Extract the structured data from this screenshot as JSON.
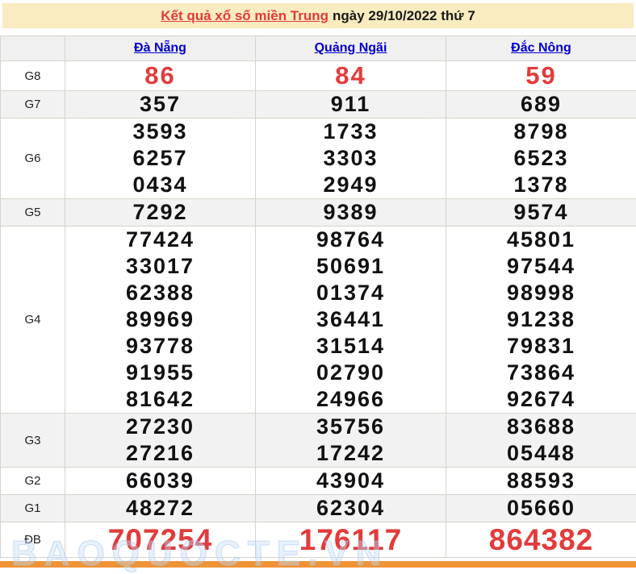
{
  "page": {
    "title_link": "Kết quả xổ số miền Trung",
    "title_rest": "ngày 29/10/2022 thứ 7"
  },
  "table": {
    "columns": [
      "Đà Nẵng",
      "Quảng Ngãi",
      "Đắc Nông"
    ],
    "rows": [
      {
        "label": "G8",
        "shade": "white",
        "variant": "red-medium",
        "values": [
          [
            "86"
          ],
          [
            "84"
          ],
          [
            "59"
          ]
        ]
      },
      {
        "label": "G7",
        "shade": "gray",
        "variant": "normal",
        "values": [
          [
            "357"
          ],
          [
            "911"
          ],
          [
            "689"
          ]
        ]
      },
      {
        "label": "G6",
        "shade": "white",
        "variant": "normal",
        "values": [
          [
            "3593",
            "6257",
            "0434"
          ],
          [
            "1733",
            "3303",
            "2949"
          ],
          [
            "8798",
            "6523",
            "1378"
          ]
        ]
      },
      {
        "label": "G5",
        "shade": "gray",
        "variant": "normal",
        "values": [
          [
            "7292"
          ],
          [
            "9389"
          ],
          [
            "9574"
          ]
        ]
      },
      {
        "label": "G4",
        "shade": "white",
        "variant": "normal",
        "values": [
          [
            "77424",
            "33017",
            "62388",
            "89969",
            "93778",
            "91955",
            "81642"
          ],
          [
            "98764",
            "50691",
            "01374",
            "36441",
            "31514",
            "02790",
            "24966"
          ],
          [
            "45801",
            "97544",
            "98998",
            "91238",
            "79831",
            "73864",
            "92674"
          ]
        ]
      },
      {
        "label": "G3",
        "shade": "gray",
        "variant": "normal",
        "values": [
          [
            "27230",
            "27216"
          ],
          [
            "35756",
            "17242"
          ],
          [
            "83688",
            "05448"
          ]
        ]
      },
      {
        "label": "G2",
        "shade": "white",
        "variant": "normal",
        "values": [
          [
            "66039"
          ],
          [
            "43904"
          ],
          [
            "88593"
          ]
        ]
      },
      {
        "label": "G1",
        "shade": "gray",
        "variant": "normal",
        "values": [
          [
            "48272"
          ],
          [
            "62304"
          ],
          [
            "05660"
          ]
        ]
      },
      {
        "label": "ĐB",
        "shade": "white",
        "variant": "red-large",
        "values": [
          [
            "707254"
          ],
          [
            "176117"
          ],
          [
            "864382"
          ]
        ]
      }
    ]
  },
  "watermark": "BAOQUOCTE.VN",
  "colors": {
    "accent_red": "#e23b3b",
    "link_blue": "#0000cd",
    "title_bg": "#f9ecc0",
    "row_gray": "#f2f2f2",
    "header_gray": "#f0f0f0",
    "border": "#d9d3cb",
    "orange_bar": "#ef9336"
  }
}
